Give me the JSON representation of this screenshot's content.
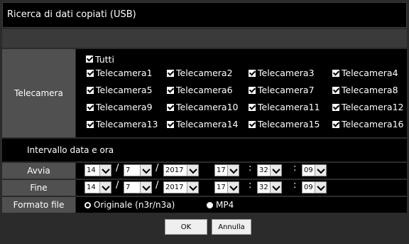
{
  "window": {
    "title": "Ricerca di dati copiati (USB)"
  },
  "camera_section": {
    "label": "Telecamera",
    "all_label": "Tutti",
    "cameras": [
      [
        "Telecamera1",
        "Telecamera2",
        "Telecamera3",
        "Telecamera4"
      ],
      [
        "Telecamera5",
        "Telecamera6",
        "Telecamera7",
        "Telecamera8"
      ],
      [
        "Telecamera9",
        "Telecamera10",
        "Telecamera11",
        "Telecamera12"
      ],
      [
        "Telecamera13",
        "Telecamera14",
        "Telecamera15",
        "Telecamera16"
      ]
    ]
  },
  "range": {
    "heading": "Intervallo data e ora",
    "start": {
      "label": "Avvia",
      "day": "14",
      "month": "7",
      "year": "2017",
      "hour": "17",
      "minute": "32",
      "second": "09"
    },
    "end": {
      "label": "Fine",
      "day": "14",
      "month": "7",
      "year": "2017",
      "hour": "17",
      "minute": "32",
      "second": "09"
    },
    "date_sep": "/",
    "time_sep": ":"
  },
  "format": {
    "label": "Formato file",
    "option_original": "Originale (n3r/n3a)",
    "option_mp4": "MP4",
    "selected": "original"
  },
  "buttons": {
    "ok": "OK",
    "cancel": "Annulla"
  }
}
